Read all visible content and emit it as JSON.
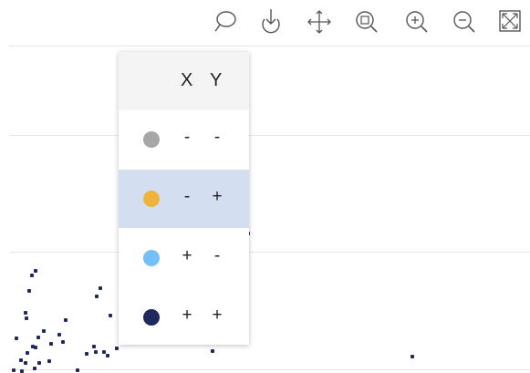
{
  "toolbar": {
    "buttons": [
      {
        "name": "lasso-select-icon"
      },
      {
        "name": "download-icon"
      },
      {
        "name": "pan-icon"
      },
      {
        "name": "box-zoom-icon"
      },
      {
        "name": "zoom-in-icon"
      },
      {
        "name": "zoom-out-icon"
      },
      {
        "name": "reset-axes-icon"
      }
    ]
  },
  "legend": {
    "header": {
      "x": "X",
      "y": "Y"
    },
    "rows": [
      {
        "color": "#a6a6a6",
        "x": "-",
        "y": "-",
        "selected": false
      },
      {
        "color": "#f0b43c",
        "x": "-",
        "y": "+",
        "selected": true
      },
      {
        "color": "#72c0f5",
        "x": "+",
        "y": "-",
        "selected": false
      },
      {
        "color": "#1f2a5c",
        "x": "+",
        "y": "+",
        "selected": false
      }
    ]
  },
  "plot": {
    "point_color": "#1f2a5c"
  }
}
